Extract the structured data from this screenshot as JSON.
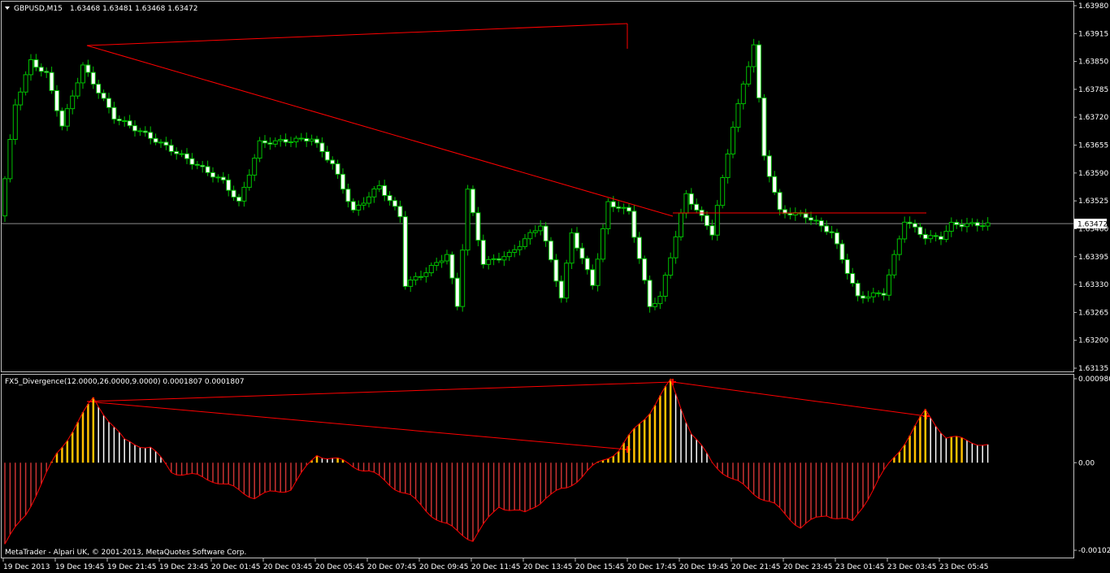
{
  "header": {
    "symbol": "GBPUSD,M15",
    "ohlc": "1.63468 1.63481 1.63468 1.63472"
  },
  "indicator": {
    "title": "FX5_Divergence(12.0000,26.0000,9.0000) 0.0001807 0.0001807"
  },
  "footer": {
    "copyright": "MetaTrader - Alpari UK, © 2001-2013, MetaQuotes Software Corp."
  },
  "colors": {
    "background": "#000000",
    "frame": "#c0c0c0",
    "candle_wick": "#00c000",
    "candle_bull": "#000000",
    "candle_bear": "#ffffff",
    "line": "#ff0000",
    "hist_pos_strong": "#ffc000",
    "hist_pos_weak": "#ffffff",
    "hist_neg": "#c83232",
    "bid_line": "#8a8a8a"
  },
  "chart_data": [
    {
      "type": "candlestick",
      "symbol": "GBPUSD",
      "timeframe": "M15",
      "current_price": "1.63472",
      "y_ticks": [
        "1.63980",
        "1.63915",
        "1.63850",
        "1.63785",
        "1.63720",
        "1.63655",
        "1.63590",
        "1.63525",
        "1.63460",
        "1.63395",
        "1.63330",
        "1.63265",
        "1.63200",
        "1.63135"
      ],
      "ylim": [
        1.6313,
        1.6398
      ],
      "trendlines": [
        {
          "from": [
            "19 Dec 19:45",
            1.6389
          ],
          "to": [
            "20 Dec 17:15",
            1.6394
          ]
        },
        {
          "from": [
            "19 Dec 19:45",
            1.6389
          ],
          "to": [
            "20 Dec 18:30",
            1.6348
          ]
        },
        {
          "from": [
            "20 Dec 18:30",
            1.6348
          ],
          "to": [
            "23 Dec 03:45",
            1.6349
          ]
        }
      ]
    },
    {
      "type": "histogram",
      "name": "FX5_Divergence",
      "y_ticks": [
        "0.000980",
        "0.00",
        "-0.001022"
      ],
      "ylim": [
        -0.001022,
        0.00098
      ],
      "signal_markers": [
        "20 Dec 16:00",
        "20 Dec 18:30",
        "23 Dec 03:45"
      ]
    }
  ],
  "x_axis": {
    "labels": [
      "19 Dec 2013",
      "19 Dec 19:45",
      "19 Dec 21:45",
      "19 Dec 23:45",
      "20 Dec 01:45",
      "20 Dec 03:45",
      "20 Dec 05:45",
      "20 Dec 07:45",
      "20 Dec 09:45",
      "20 Dec 11:45",
      "20 Dec 13:45",
      "20 Dec 15:45",
      "20 Dec 17:45",
      "20 Dec 19:45",
      "20 Dec 21:45",
      "20 Dec 23:45",
      "23 Dec 01:45",
      "23 Dec 03:45",
      "23 Dec 05:45"
    ]
  }
}
